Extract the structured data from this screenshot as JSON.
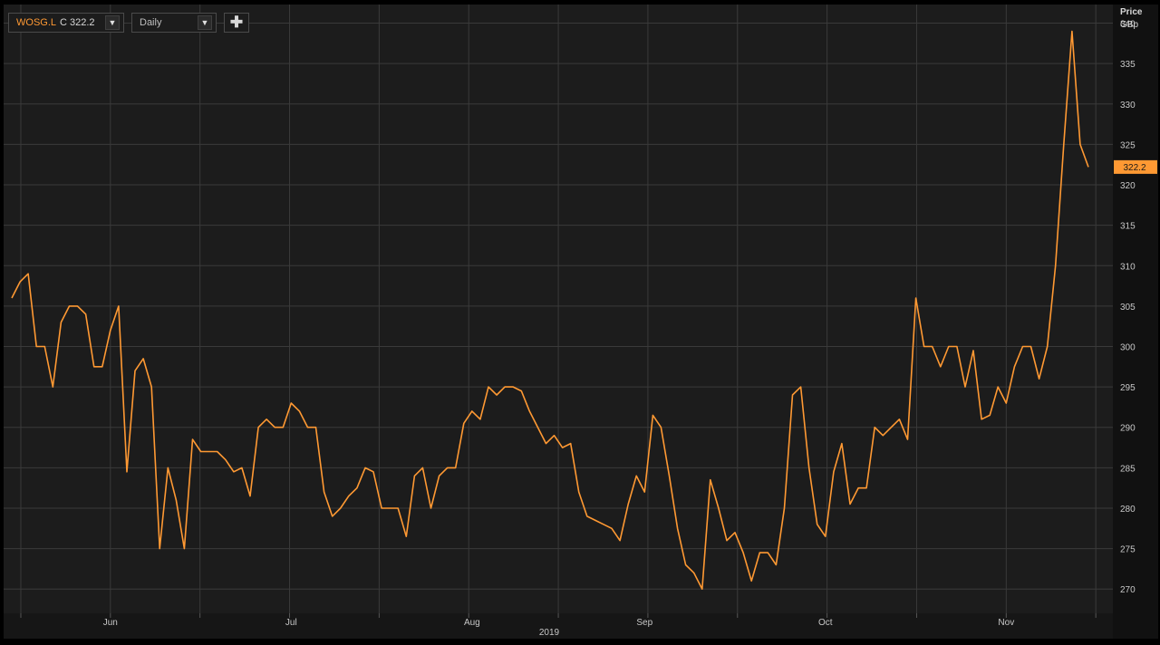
{
  "toolbar": {
    "ric": "WOSG.L",
    "close_prefix": "C",
    "close_value": "322.2",
    "interval": "Daily",
    "caret_glyph": "▼",
    "add_glyph": "✚"
  },
  "chart_data": {
    "type": "line",
    "series": [
      {
        "name": "",
        "color": "#ff9933",
        "values": [
          306,
          308,
          309,
          300,
          300,
          295,
          303,
          305,
          305,
          304,
          297.5,
          297.5,
          302,
          305,
          284.5,
          297,
          298.5,
          295,
          275,
          285,
          281,
          275,
          288.5,
          287,
          287,
          287,
          286,
          284.5,
          285,
          281.5,
          290,
          291,
          290,
          290,
          293,
          292,
          290,
          290,
          282,
          279,
          280,
          281.5,
          282.5,
          285,
          284.5,
          280,
          280,
          280,
          276.5,
          284,
          285,
          280,
          284,
          285,
          285,
          290.5,
          292,
          291,
          295,
          294,
          295,
          295,
          294.5,
          292,
          290,
          288,
          289,
          287.5,
          288,
          282,
          279,
          278.5,
          278,
          277.5,
          276,
          280.5,
          284,
          282,
          291.5,
          290,
          284,
          277.5,
          273,
          272,
          270,
          283.5,
          280,
          276,
          277,
          274.5,
          271,
          274.5,
          274.5,
          273,
          280,
          294,
          295,
          285,
          278,
          276.5,
          284.5,
          288,
          280.5,
          282.5,
          282.5,
          290,
          289,
          290,
          291,
          288.5,
          306,
          300,
          300,
          297.5,
          300,
          300,
          295,
          299.5,
          291,
          291.5,
          295,
          293,
          297.5,
          300,
          300,
          296,
          300,
          310,
          325,
          339,
          325,
          322.2
        ]
      }
    ],
    "x_tick_labels": [
      "Jun",
      "Jul",
      "Aug",
      "Sep",
      "Oct",
      "Nov"
    ],
    "x_tick_index": [
      12,
      34,
      56,
      77,
      99,
      121
    ],
    "year_label": "2019",
    "y_axis_title": [
      "Price",
      "GBp"
    ],
    "y_ticks": [
      270,
      275,
      280,
      285,
      290,
      295,
      300,
      305,
      310,
      315,
      320,
      325,
      330,
      335,
      340
    ],
    "ylim": [
      267,
      342.3
    ],
    "last_value_label": "322.2",
    "grid": true,
    "colors": {
      "background": "#1c1c1c",
      "grid": "#3a3a3a",
      "line": "#ff9933",
      "axis_text": "#c8c8c8"
    }
  }
}
